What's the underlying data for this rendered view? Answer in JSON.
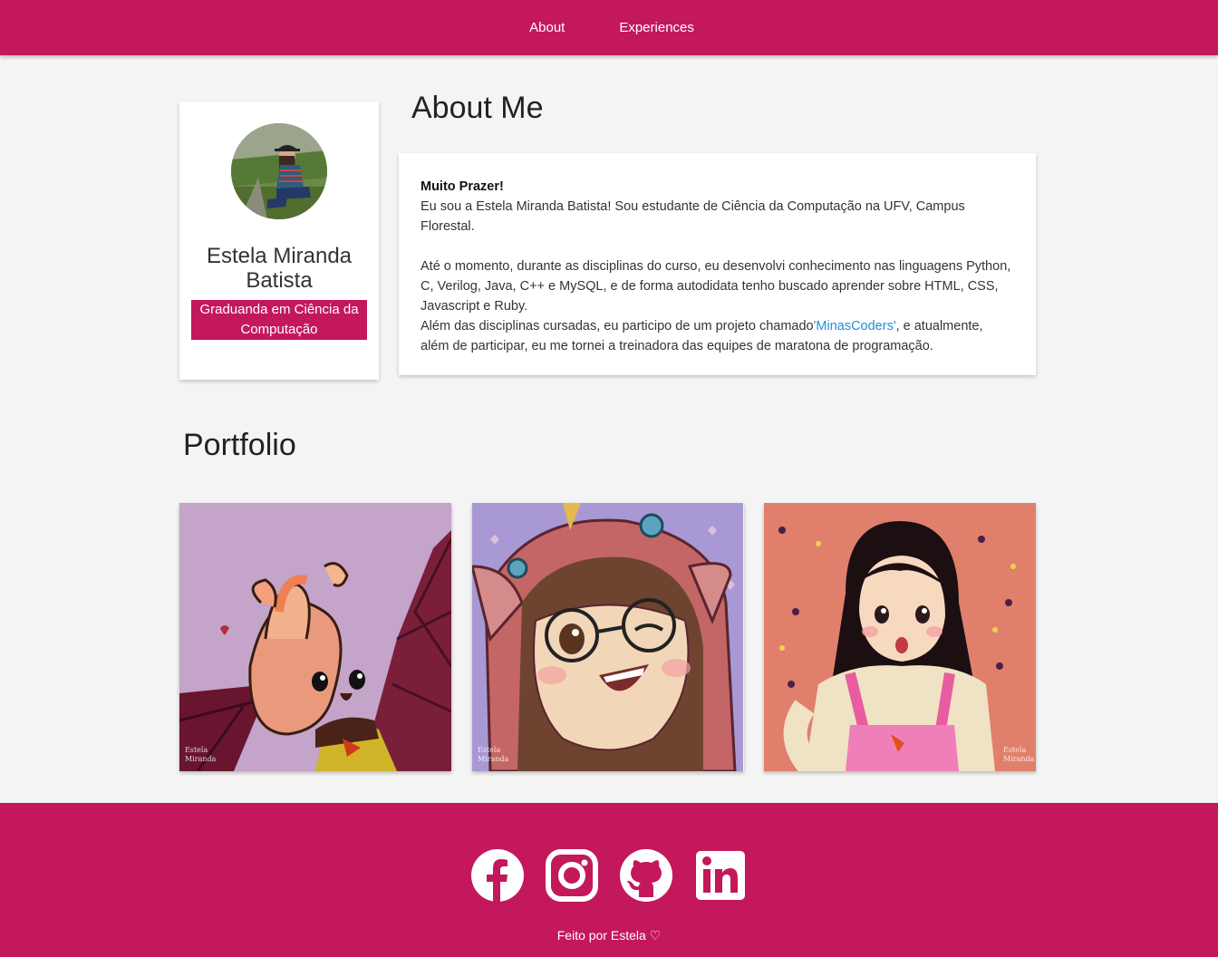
{
  "nav": {
    "items": [
      {
        "label": "About"
      },
      {
        "label": "Experiences"
      }
    ]
  },
  "profile": {
    "name": "Estela Miranda Batista",
    "role": "Graduanda em Ciência da Computação"
  },
  "about": {
    "title": "About Me",
    "greeting": "Muito Prazer!",
    "p1": "Eu sou a Estela Miranda Batista! Sou estudante de Ciência da Computação na UFV, Campus Florestal.",
    "p2": "Até o momento, durante as disciplinas do curso, eu desenvolvi conhecimento nas linguagens Python, C, Verilog, Java, C++ e MySQL, e de forma autodidata tenho buscado aprender sobre HTML, CSS, Javascript e Ruby.",
    "p3_before": "Além das disciplinas cursadas, eu participo de um projeto chamado",
    "p3_link": "'MinasCoders'",
    "p3_after": ", e atualmente, além de participar, eu me tornei a treinadora das equipes de maratona de programação."
  },
  "portfolio": {
    "title": "Portfolio",
    "items": [
      {
        "signature": "Estela Miranda"
      },
      {
        "signature": "Estela Miranda"
      },
      {
        "signature": "Estela Miranda"
      }
    ]
  },
  "footer": {
    "text": "Feito por Estela ♡",
    "icons": [
      "facebook-icon",
      "instagram-icon",
      "github-icon",
      "linkedin-icon"
    ]
  },
  "colors": {
    "accent": "#c3185b",
    "background": "#f4f4f4",
    "link": "#1f8fd6"
  }
}
